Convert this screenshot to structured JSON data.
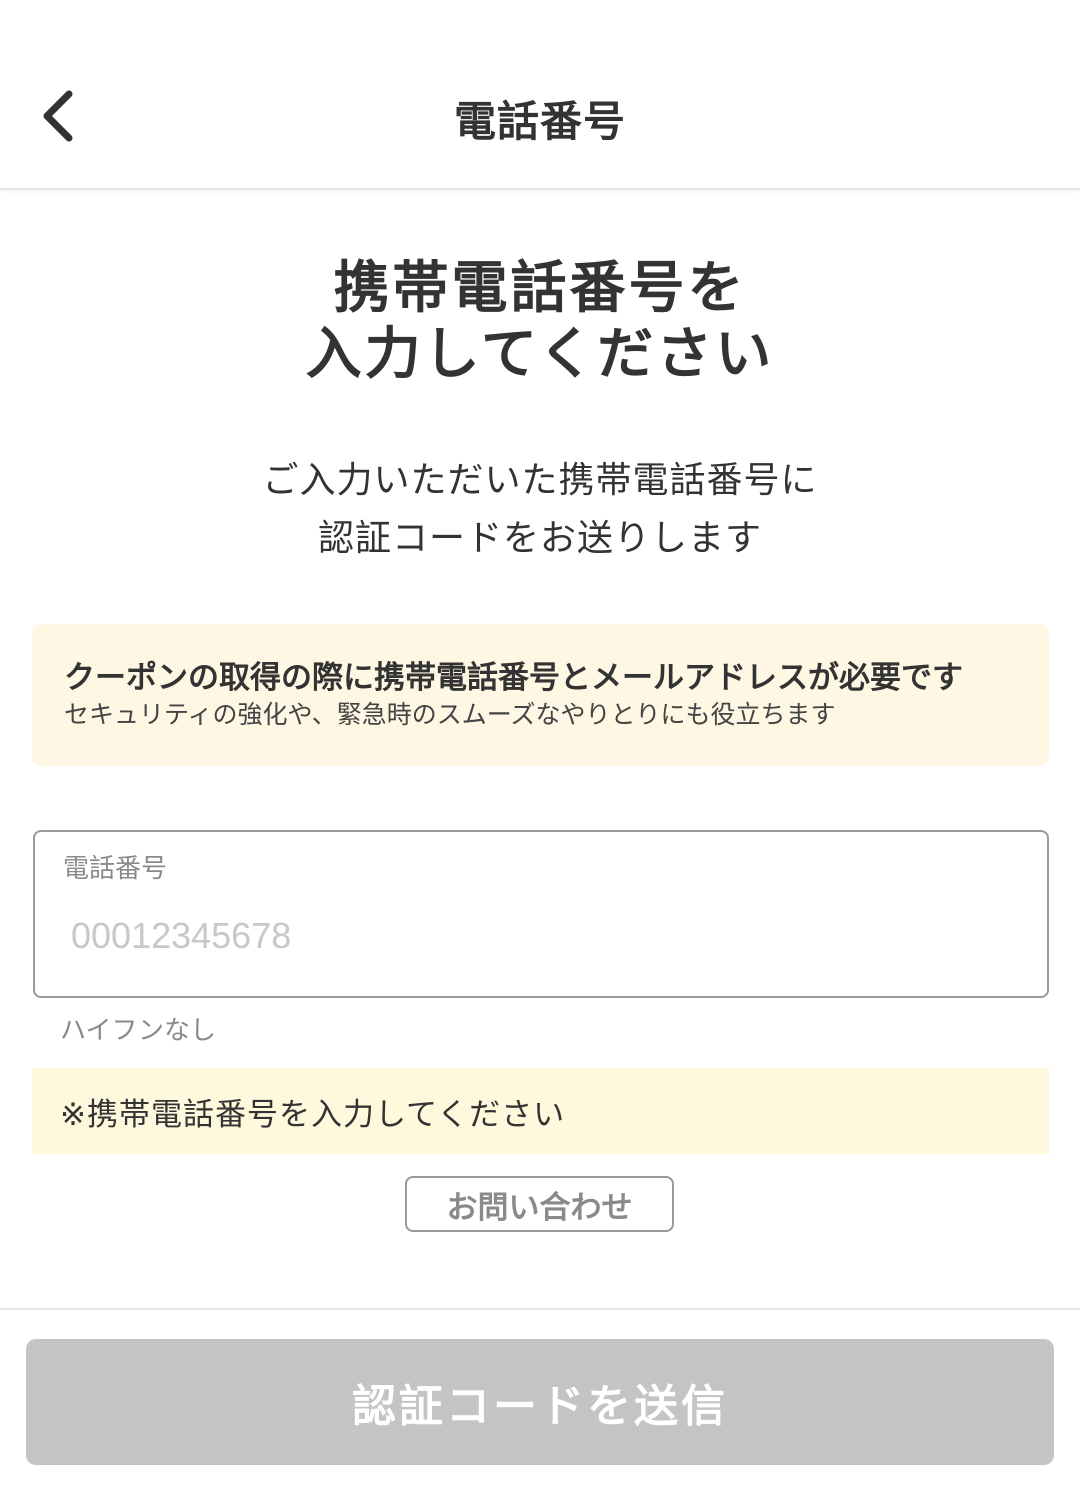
{
  "header": {
    "title": "電話番号",
    "back_icon": "chevron-left-icon"
  },
  "main": {
    "heading_line1": "携帯電話番号を",
    "heading_line2": "入力してください",
    "subtext_line1": "ご入力いただいた携帯電話番号に",
    "subtext_line2": "認証コードをお送りします"
  },
  "notice": {
    "title": "クーポンの取得の際に携帯電話番号とメールアドレスが必要です",
    "text": "セキュリティの強化や、緊急時のスムーズなやりとりにも役立ちます",
    "background": "#fdf7e3"
  },
  "phone_field": {
    "label": "電話番号",
    "value": "",
    "placeholder": "00012345678",
    "hint": "ハイフンなし"
  },
  "error": {
    "message": "※携帯電話番号を入力してください",
    "background": "#fef8dc"
  },
  "contact": {
    "label": "お問い合わせ"
  },
  "footer": {
    "submit_label": "認証コードを送信",
    "submit_disabled_color": "#c4c4c4"
  }
}
